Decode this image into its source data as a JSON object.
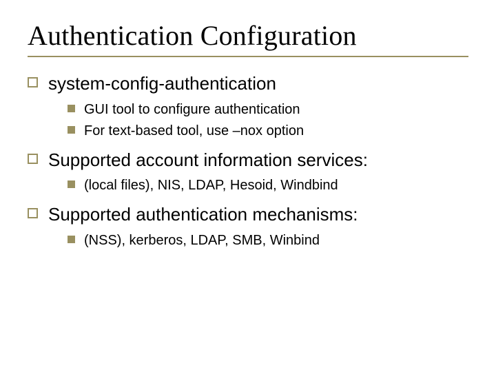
{
  "title": "Authentication Configuration",
  "items": [
    {
      "text": "system-config-authentication",
      "sub": [
        {
          "text": "GUI tool  to configure authentication"
        },
        {
          "text": "For text-based tool, use –nox option"
        }
      ]
    },
    {
      "text": "Supported account information services:",
      "sub": [
        {
          "text": "(local files), NIS, LDAP, Hesoid, Windbind"
        }
      ]
    },
    {
      "text": "Supported authentication mechanisms:",
      "sub": [
        {
          "text": "(NSS), kerberos, LDAP, SMB, Winbind"
        }
      ]
    }
  ]
}
